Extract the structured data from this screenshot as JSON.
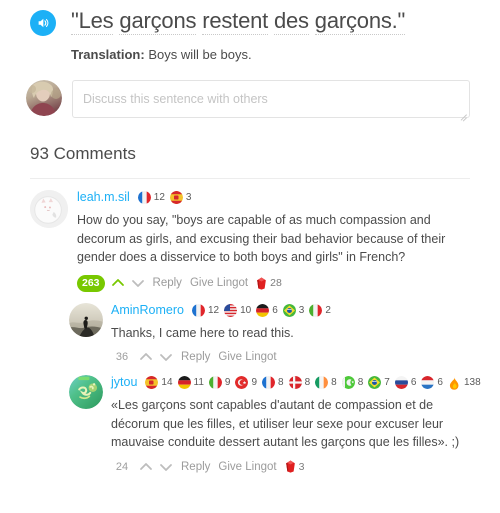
{
  "sentence": {
    "speaker_icon": "speaker-icon",
    "words": [
      "\"Les",
      "garçons",
      "restent",
      "des",
      "garçons.\""
    ],
    "full_text": "\"Les garçons restent des garçons.\""
  },
  "translation": {
    "label": "Translation:",
    "text": "Boys will be boys."
  },
  "composer": {
    "placeholder": "Discuss this sentence with others",
    "value": ""
  },
  "comments_header": "93 Comments",
  "actions": {
    "reply": "Reply",
    "give_lingot": "Give Lingot",
    "upvote_icon": "chevron-up-icon",
    "downvote_icon": "chevron-down-icon",
    "lingot_icon": "ruby-icon"
  },
  "colors": {
    "accent_blue": "#1cb0f6",
    "green": "#78c800",
    "lingot_red": "#e02020",
    "muted": "#9b9b9b"
  },
  "comments": [
    {
      "id": "comment-leah",
      "username": "leah.m.sil",
      "avatar": "cat-photo-avatar",
      "languages": [
        {
          "flag": "france",
          "name": "French",
          "count": "12"
        },
        {
          "flag": "spain",
          "name": "Spanish",
          "count": "3"
        }
      ],
      "text": "How do you say, \"boys are capable of as much compassion and decorum as girls, and excusing their bad behavior because of their gender does a disservice to both boys and girls\" in French?",
      "score": "263",
      "score_style": "pill",
      "upvoted": true,
      "lingots": "28",
      "indent": 0
    },
    {
      "id": "comment-aminromero",
      "username": "AminRomero",
      "avatar": "painting-avatar",
      "languages": [
        {
          "flag": "france",
          "name": "French",
          "count": "12"
        },
        {
          "flag": "usa",
          "name": "English",
          "count": "10"
        },
        {
          "flag": "germany",
          "name": "German",
          "count": "6"
        },
        {
          "flag": "brazil",
          "name": "Portuguese",
          "count": "3"
        },
        {
          "flag": "italy",
          "name": "Italian",
          "count": "2"
        }
      ],
      "text": "Thanks, I came here to read this.",
      "score": "36",
      "score_style": "plain",
      "upvoted": false,
      "lingots": null,
      "indent": 1
    },
    {
      "id": "comment-jytou",
      "username": "jytou",
      "avatar": "om-symbol-avatar",
      "languages": [
        {
          "flag": "spain",
          "name": "Spanish",
          "count": "14"
        },
        {
          "flag": "germany",
          "name": "German",
          "count": "11"
        },
        {
          "flag": "italy",
          "name": "Italian",
          "count": "9"
        },
        {
          "flag": "turkey",
          "name": "Turkish",
          "count": "9"
        },
        {
          "flag": "france",
          "name": "French",
          "count": "8"
        },
        {
          "flag": "denmark",
          "name": "Danish",
          "count": "8"
        },
        {
          "flag": "ireland",
          "name": "Irish",
          "count": "8"
        },
        {
          "flag": "pakistan",
          "name": "Urdu",
          "count": "8"
        },
        {
          "flag": "brazil",
          "name": "Portuguese",
          "count": "7"
        },
        {
          "flag": "russia",
          "name": "Russian",
          "count": "6"
        },
        {
          "flag": "netherlands",
          "name": "Dutch",
          "count": "6"
        },
        {
          "flag": "streak",
          "name": "Day streak",
          "count": "138"
        }
      ],
      "text": "«Les garçons sont capables d'autant de compassion et de décorum que les filles, et utiliser leur sexe pour excuser leur mauvaise conduite dessert autant les garçons que les filles». ;)",
      "score": "24",
      "score_style": "plain",
      "upvoted": false,
      "lingots": "3",
      "indent": 1
    }
  ]
}
